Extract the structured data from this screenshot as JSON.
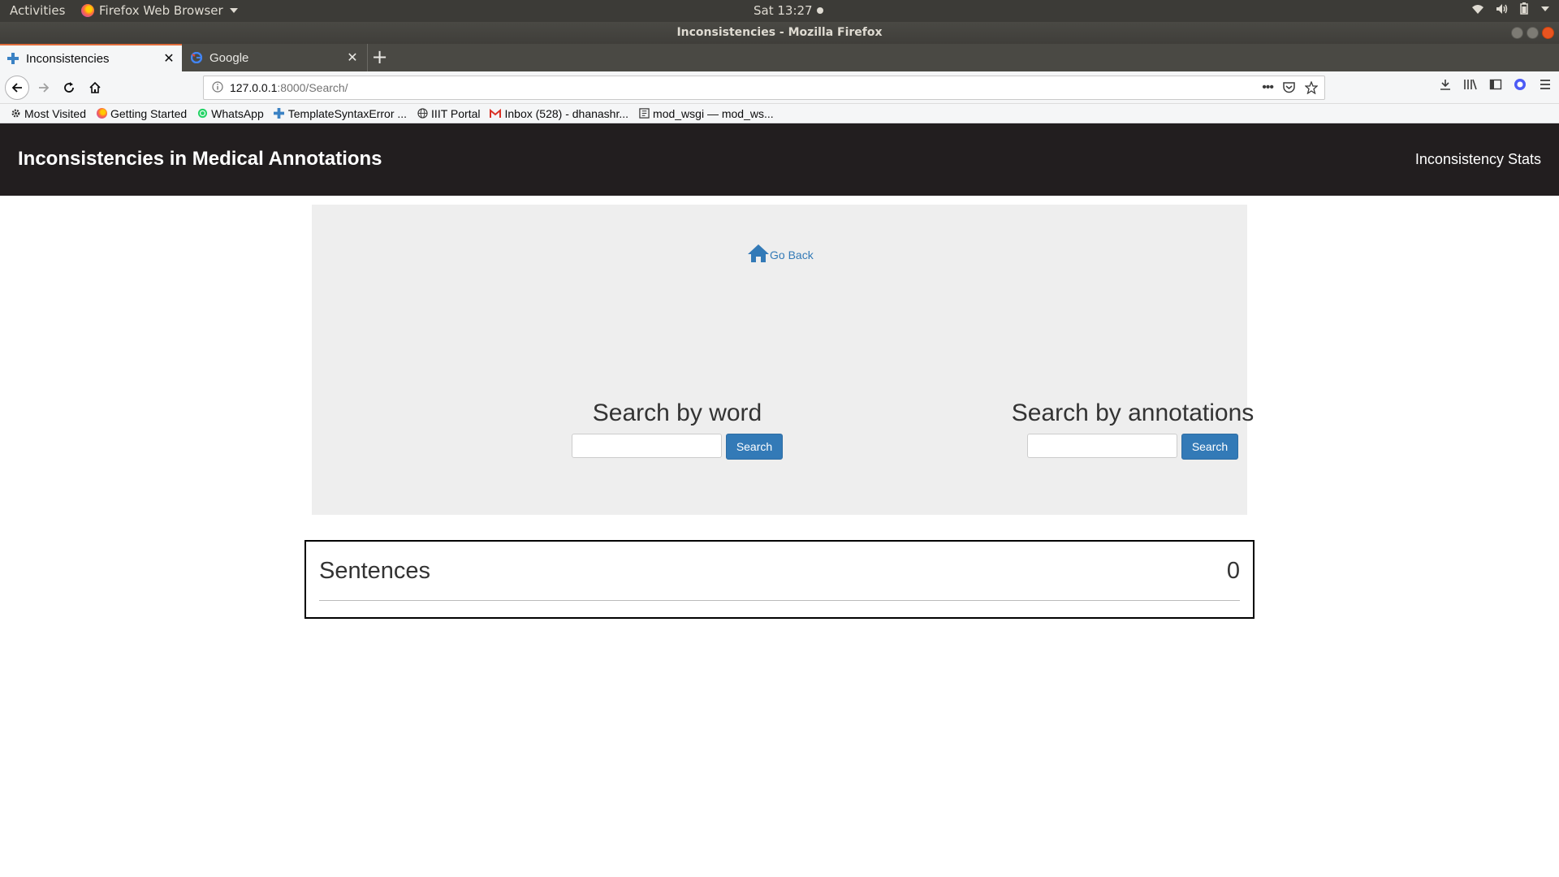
{
  "system": {
    "activities": "Activities",
    "app_menu": "Firefox Web Browser",
    "clock": "Sat 13:27"
  },
  "window": {
    "title": "Inconsistencies - Mozilla Firefox"
  },
  "tabs": [
    {
      "label": "Inconsistencies",
      "active": true
    },
    {
      "label": "Google",
      "active": false
    }
  ],
  "url": {
    "host": "127.0.0.1",
    "path": ":8000/Search/"
  },
  "bookmarks": [
    {
      "label": "Most Visited",
      "icon": "gear-icon"
    },
    {
      "label": "Getting Started",
      "icon": "firefox-icon"
    },
    {
      "label": "WhatsApp",
      "icon": "whatsapp-icon"
    },
    {
      "label": "TemplateSyntaxError ...",
      "icon": "django-icon"
    },
    {
      "label": "IIIT Portal",
      "icon": "globe-icon"
    },
    {
      "label": "Inbox (528) - dhanashr...",
      "icon": "gmail-icon"
    },
    {
      "label": "mod_wsgi — mod_ws...",
      "icon": "doc-icon"
    }
  ],
  "site": {
    "brand": "Inconsistencies in Medical Annotations",
    "nav_link": "Inconsistency Stats",
    "go_back": "Go Back",
    "search_word": {
      "heading": "Search by word",
      "value": "",
      "button": "Search"
    },
    "search_annotations": {
      "heading": "Search by annotations",
      "value": "",
      "button": "Search"
    },
    "sentences": {
      "title": "Sentences",
      "count": "0"
    }
  },
  "colors": {
    "navbar": "#221e1f",
    "primary": "#337ab7",
    "jumbotron": "#eeeeee"
  }
}
